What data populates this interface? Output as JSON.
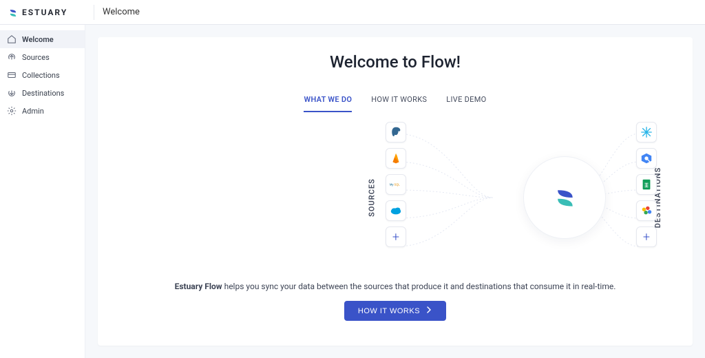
{
  "brand": {
    "word": "ESTUARY"
  },
  "topbar": {
    "page_title": "Welcome"
  },
  "sidebar": {
    "items": [
      {
        "label": "Welcome",
        "icon": "home-icon",
        "active": true
      },
      {
        "label": "Sources",
        "icon": "upload-icon",
        "active": false
      },
      {
        "label": "Collections",
        "icon": "layers-icon",
        "active": false
      },
      {
        "label": "Destinations",
        "icon": "download-icon",
        "active": false
      },
      {
        "label": "Admin",
        "icon": "gear-icon",
        "active": false
      }
    ]
  },
  "welcome": {
    "title": "Welcome to Flow!",
    "tabs": [
      {
        "label": "WHAT WE DO",
        "active": true
      },
      {
        "label": "HOW IT WORKS",
        "active": false
      },
      {
        "label": "LIVE DEMO",
        "active": false
      }
    ],
    "sources_label": "SOURCES",
    "destinations_label": "DESTINATIONS",
    "sources": [
      {
        "name": "postgresql-icon"
      },
      {
        "name": "firebase-icon"
      },
      {
        "name": "mysql-icon"
      },
      {
        "name": "salesforce-icon"
      },
      {
        "name": "add-source-icon",
        "is_add": true
      }
    ],
    "destinations": [
      {
        "name": "snowflake-icon"
      },
      {
        "name": "bigquery-icon"
      },
      {
        "name": "google-sheets-icon"
      },
      {
        "name": "analytics-icon"
      },
      {
        "name": "add-destination-icon",
        "is_add": true
      }
    ],
    "description_bold": "Estuary Flow",
    "description_rest": " helps you sync your data between the sources that produce it and destinations that consume it in real-time.",
    "cta_label": "HOW IT WORKS"
  }
}
